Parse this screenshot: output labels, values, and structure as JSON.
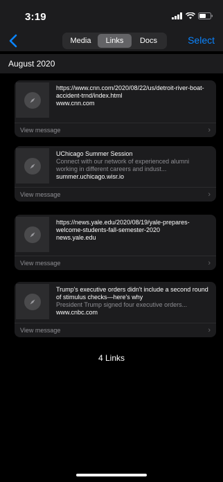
{
  "status": {
    "time": "3:19"
  },
  "nav": {
    "tabs": [
      {
        "label": "Media",
        "active": false
      },
      {
        "label": "Links",
        "active": true
      },
      {
        "label": "Docs",
        "active": false
      }
    ],
    "select_label": "Select"
  },
  "section": {
    "title": "August 2020"
  },
  "links": [
    {
      "title": "https://www.cnn.com/2020/08/22/us/detroit-river-boat-accident-trnd/index.html",
      "subtitle": "",
      "domain": "www.cnn.com",
      "footer": "View message"
    },
    {
      "title": "UChicago Summer Session",
      "subtitle": "Connect with our network of experienced alumni working in different careers and indust...",
      "domain": "summer.uchicago.wisr.io",
      "footer": "View message"
    },
    {
      "title": "https://news.yale.edu/2020/08/19/yale-prepares-welcome-students-fall-semester-2020",
      "subtitle": "",
      "domain": "news.yale.edu",
      "footer": "View message"
    },
    {
      "title": "Trump's executive orders didn't include a second round of stimulus checks—here's why",
      "subtitle": "President Trump signed four executive orders...",
      "domain": "www.cnbc.com",
      "footer": "View message"
    }
  ],
  "summary": {
    "count_label": "4 Links"
  },
  "colors": {
    "accent": "#0a84ff",
    "background": "#000000",
    "card": "#1c1c1e"
  }
}
